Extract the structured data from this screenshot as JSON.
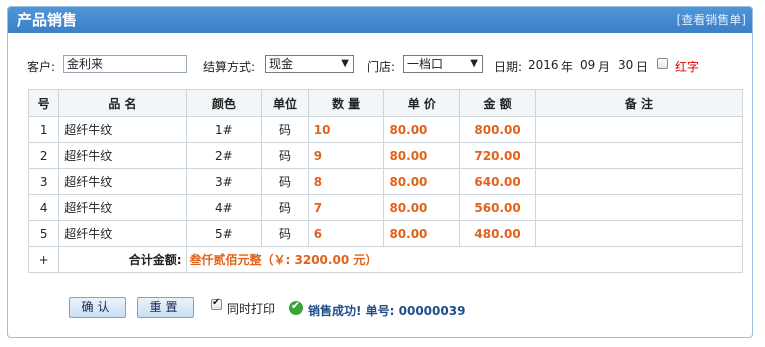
{
  "header": {
    "title": "产品销售",
    "view_link": "[查看销售单]"
  },
  "form": {
    "customer_label": "客户:",
    "customer_value": "金利来",
    "payment_label": "结算方式:",
    "payment_value": "现金",
    "store_label": "门店:",
    "store_value": "一档口",
    "date_label": "日期:",
    "date_year": "2016",
    "year_unit": "年",
    "date_month": "09",
    "month_unit": "月",
    "date_day": "30",
    "day_unit": "日",
    "red_label": "红字",
    "red_checked": false
  },
  "table": {
    "headers": {
      "no": "号",
      "name": "品 名",
      "color": "颜色",
      "unit": "单位",
      "qty": "数 量",
      "price": "单 价",
      "amount": "金 额",
      "note": "备 注"
    },
    "rows": [
      {
        "no": "1",
        "name": "超纤牛纹",
        "color": "1#",
        "unit": "码",
        "qty": "10",
        "price": "80.00",
        "amount": "800.00",
        "note": ""
      },
      {
        "no": "2",
        "name": "超纤牛纹",
        "color": "2#",
        "unit": "码",
        "qty": "9",
        "price": "80.00",
        "amount": "720.00",
        "note": ""
      },
      {
        "no": "3",
        "name": "超纤牛纹",
        "color": "3#",
        "unit": "码",
        "qty": "8",
        "price": "80.00",
        "amount": "640.00",
        "note": ""
      },
      {
        "no": "4",
        "name": "超纤牛纹",
        "color": "4#",
        "unit": "码",
        "qty": "7",
        "price": "80.00",
        "amount": "560.00",
        "note": ""
      },
      {
        "no": "5",
        "name": "超纤牛纹",
        "color": "5#",
        "unit": "码",
        "qty": "6",
        "price": "80.00",
        "amount": "480.00",
        "note": ""
      }
    ],
    "add_row_symbol": "+",
    "total_label": "合计金额:",
    "total_text": "叁仟贰佰元整（￥: 3200.00 元）"
  },
  "actions": {
    "confirm_label": "确认",
    "reset_label": "重置",
    "print_label": "同时打印",
    "print_checked": true,
    "success_text": "销售成功! 单号: 00000039"
  },
  "colors": {
    "accent_orange": "#e2621b",
    "header_blue": "#3b7fc6",
    "success_green": "#3aa33a",
    "red_label": "#e00000"
  }
}
